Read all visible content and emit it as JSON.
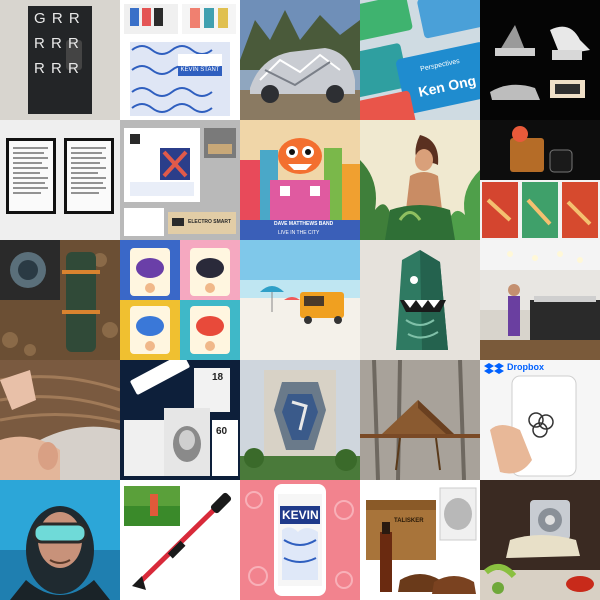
{
  "grid": {
    "tiles": [
      {
        "name": "grr-black-box",
        "text": {
          "line1": "G R R",
          "line2": "R R R",
          "line3": "R R R"
        }
      },
      {
        "name": "kevin-stationery",
        "text": {
          "card": "KEVIN STANT"
        }
      },
      {
        "name": "foil-wrapped-car"
      },
      {
        "name": "colorful-cards",
        "text": {
          "name": "Ken Ong",
          "tag": "Perspectives"
        }
      },
      {
        "name": "playground-dark"
      },
      {
        "name": "framed-posters"
      },
      {
        "name": "business-collateral",
        "text": {
          "label": "ELECTRO SMART"
        }
      },
      {
        "name": "monster-city-poster",
        "text": {
          "caption": "DAVE MATTHEWS BAND",
          "sub": "LIVE IN THE CITY"
        }
      },
      {
        "name": "jungle-illustration"
      },
      {
        "name": "cocktail-packaging"
      },
      {
        "name": "thermos-product"
      },
      {
        "name": "character-cards"
      },
      {
        "name": "beach-food-truck"
      },
      {
        "name": "paper-monster-sculpture"
      },
      {
        "name": "store-interior"
      },
      {
        "name": "hair-portrait"
      },
      {
        "name": "bee-packaging",
        "text": {
          "n1": "18",
          "n2": "60"
        }
      },
      {
        "name": "building-mural"
      },
      {
        "name": "wooden-birdhouse"
      },
      {
        "name": "dropbox-app",
        "text": {
          "brand": "Dropbox"
        }
      },
      {
        "name": "diver-mask"
      },
      {
        "name": "reach-grabber-tool"
      },
      {
        "name": "kevin-app-screen",
        "text": {
          "title": "KEVIN"
        }
      },
      {
        "name": "whisky-gift-box",
        "text": {
          "label": "TALISKER"
        }
      },
      {
        "name": "pasta-machine"
      }
    ]
  },
  "colors": {
    "bg": "#ffffff",
    "dropbox_blue": "#0061ff"
  }
}
